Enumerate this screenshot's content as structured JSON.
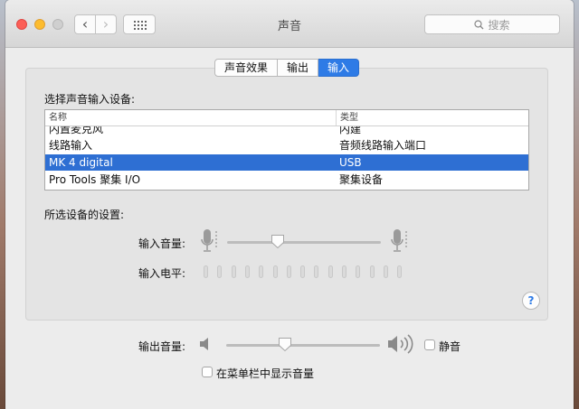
{
  "window": {
    "title": "声音",
    "nav": {
      "back_glyph": "‹",
      "forward_glyph": "›"
    },
    "search": {
      "placeholder": "搜索",
      "icon": "search-icon"
    }
  },
  "tabs": [
    {
      "label": "声音效果",
      "active": false
    },
    {
      "label": "输出",
      "active": false
    },
    {
      "label": "输入",
      "active": true
    }
  ],
  "input_panel": {
    "select_device_label": "选择声音输入设备:",
    "table": {
      "columns": [
        "名称",
        "类型"
      ],
      "rows": [
        {
          "name": "内置麦克风",
          "type": "内建",
          "selected": false
        },
        {
          "name": "线路输入",
          "type": "音频线路输入端口",
          "selected": false
        },
        {
          "name": "MK 4 digital",
          "type": "USB",
          "selected": true
        },
        {
          "name": "Pro Tools 聚集 I/O",
          "type": "聚集设备",
          "selected": false
        }
      ]
    },
    "settings_label": "所选设备的设置:",
    "input_volume_label": "输入音量:",
    "input_volume_value": 0.33,
    "input_level_label": "输入电平:",
    "input_level_segments": 15,
    "input_level_active": 0,
    "help_label": "?"
  },
  "footer": {
    "output_volume_label": "输出音量:",
    "output_volume_value": 0.38,
    "mute_label": "静音",
    "mute_checked": false,
    "show_in_menubar_label": "在菜单栏中显示音量",
    "show_in_menubar_checked": false
  },
  "colors": {
    "accent": "#2e7be6",
    "selection": "#2e6fd3"
  }
}
